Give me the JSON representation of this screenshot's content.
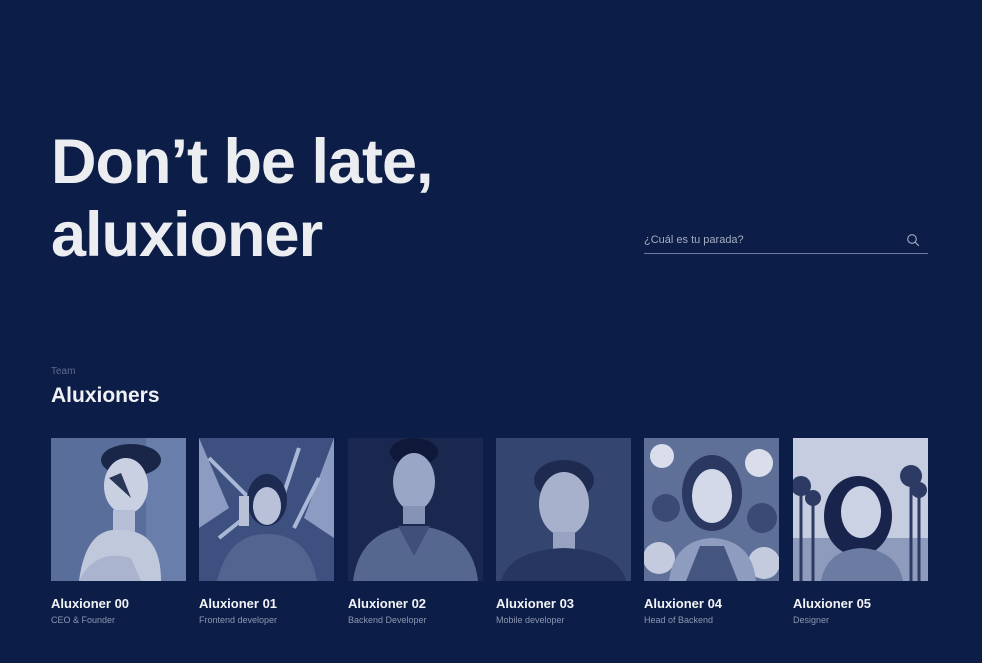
{
  "hero": {
    "line1": "Don’t be late,",
    "line2": "aluxioner"
  },
  "search": {
    "placeholder": "¿Cuál es tu parada?",
    "icon": "search-icon"
  },
  "team_section": {
    "eyebrow": "Team",
    "title": "Aluxioners",
    "members": [
      {
        "name": "Aluxioner 00",
        "role": "CEO & Founder"
      },
      {
        "name": "Aluxioner 01",
        "role": "Frontend developer"
      },
      {
        "name": "Aluxioner 02",
        "role": "Backend Developer"
      },
      {
        "name": "Aluxioner 03",
        "role": "Mobile developer"
      },
      {
        "name": "Aluxioner 04",
        "role": "Head of Backend"
      },
      {
        "name": "Aluxioner 05",
        "role": "Designer"
      }
    ]
  },
  "colors": {
    "background": "#0c1d47",
    "text": "#ecedf1",
    "muted": "#8c97b2"
  }
}
